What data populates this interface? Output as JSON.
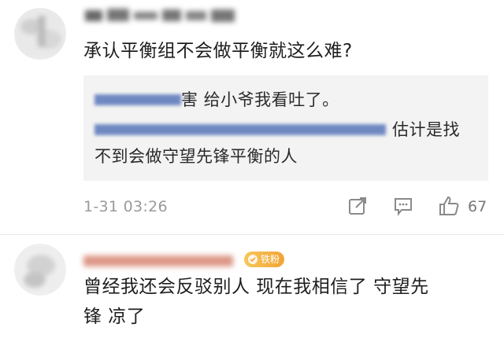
{
  "comments": [
    {
      "text": "承认平衡组不会做平衡就这么难?",
      "reply": {
        "line1": "害 给小爷我看吐了。",
        "line2": "估计是找",
        "line3": "不到会做守望先锋平衡的人"
      },
      "timestamp": "1-31 03:26",
      "like_count": "67",
      "icons": {
        "share": "share-icon",
        "reply": "comment-icon",
        "like": "thumbs-up-icon"
      }
    },
    {
      "badge_label": "铁粉",
      "text_line1": "曾经我还会反驳别人 现在我相信了 守望先",
      "text_line2": "锋 凉了"
    }
  ],
  "colors": {
    "text": "#1e1e1e",
    "meta": "#9a9a9a",
    "reply_bg": "#f3f3f3",
    "link": "#5b78b8",
    "badge": "#f2a436"
  }
}
